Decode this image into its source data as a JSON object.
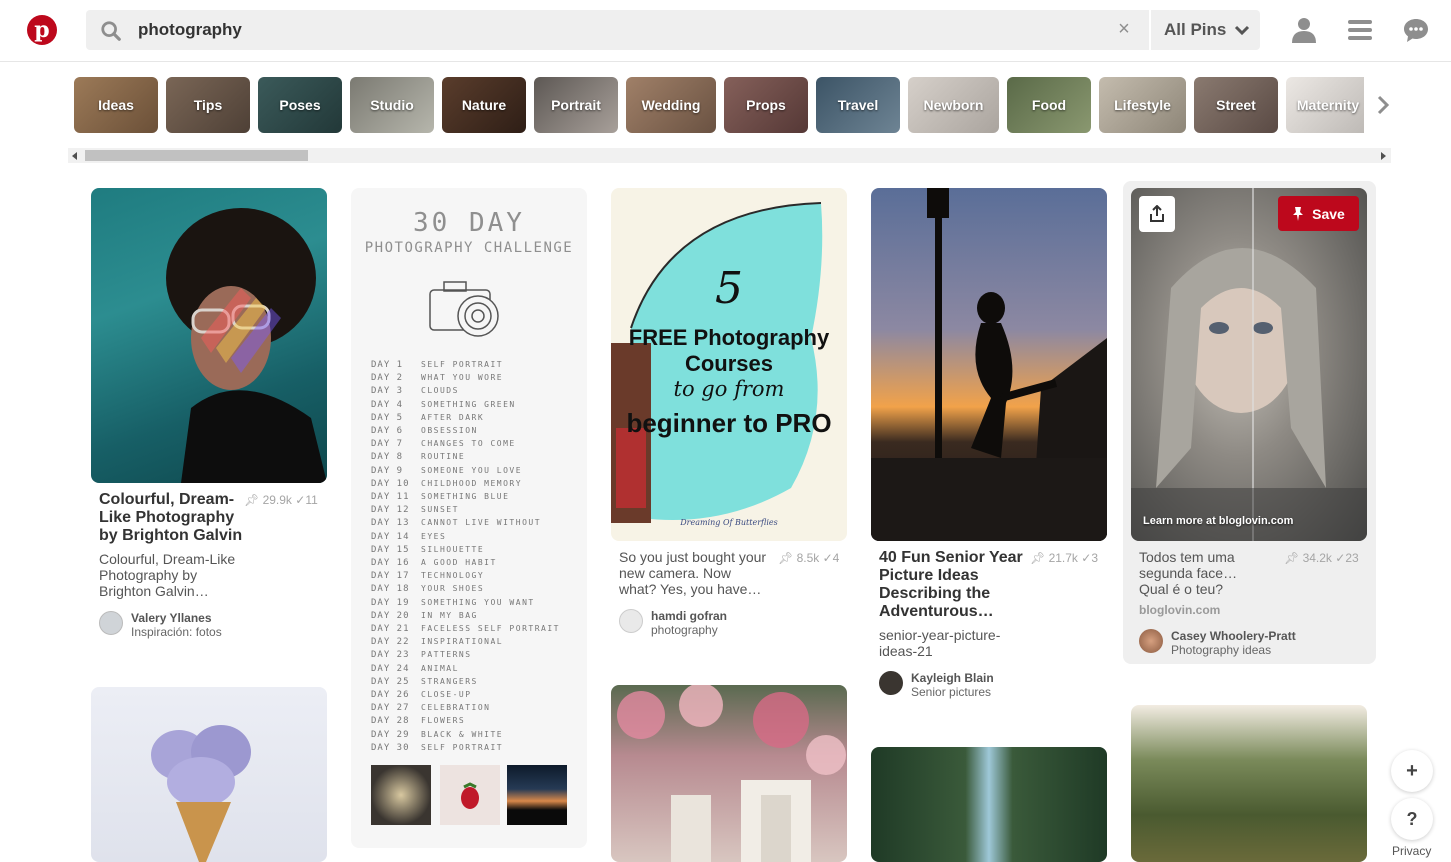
{
  "header": {
    "logo_letter": "p",
    "search_value": "photography",
    "clear_glyph": "×",
    "scope_label": "All Pins",
    "icons": [
      "pinterest-logo-icon",
      "search-icon",
      "clear-icon",
      "chevron-down-icon",
      "profile-icon",
      "menu-icon",
      "messages-icon"
    ]
  },
  "categories": [
    {
      "label": "Ideas",
      "color": "#8c6b4e"
    },
    {
      "label": "Tips",
      "color": "#6b5a4a"
    },
    {
      "label": "Poses",
      "color": "#2f4a4a"
    },
    {
      "label": "Studio",
      "color": "#9a9a90"
    },
    {
      "label": "Nature",
      "color": "#4a3326"
    },
    {
      "label": "Portrait",
      "color": "#7d7570"
    },
    {
      "label": "Wedding",
      "color": "#8a6e5a"
    },
    {
      "label": "Props",
      "color": "#6e4a48"
    },
    {
      "label": "Travel",
      "color": "#4a6070"
    },
    {
      "label": "Newborn",
      "color": "#c9c4be"
    },
    {
      "label": "Food",
      "color": "#6d7a5a"
    },
    {
      "label": "Lifestyle",
      "color": "#b0a89a"
    },
    {
      "label": "Street",
      "color": "#7a6a60"
    },
    {
      "label": "Maternity",
      "color": "#d8d4d0"
    }
  ],
  "pins": {
    "p1": {
      "title": "Colourful, Dream-Like Photography by Brighton Galvin",
      "desc": "Colourful, Dream-Like Photography by Brighton Galvin…",
      "saves": "29.9k",
      "tries": "11",
      "user": "Valery Yllanes",
      "board": "Inspiración: fotos"
    },
    "p3": {
      "desc": "So you just bought your new camera. Now what? Yes, you have…",
      "saves": "8.5k",
      "tries": "4",
      "user": "hamdi gofran",
      "board": "photography",
      "img_number": "5",
      "img_line1": "FREE Photography",
      "img_line2": "Courses",
      "img_line3": "to go from",
      "img_line4": "beginner to PRO",
      "img_credit": "Dreaming Of Butterflies"
    },
    "p4": {
      "title": "40 Fun Senior Year Picture Ideas Describing the Adventurous…",
      "desc": "senior-year-picture-ideas-21",
      "saves": "21.7k",
      "tries": "3",
      "user": "Kayleigh Blain",
      "board": "Senior pictures"
    },
    "p5": {
      "desc": "Todos tem uma segunda face… Qual é o teu?",
      "source": "bloglovin.com",
      "saves": "34.2k",
      "tries": "23",
      "user": "Casey Whoolery-Pratt",
      "board": "Photography ideas",
      "learn_more": "Learn more at bloglovin.com",
      "save_label": "Save"
    }
  },
  "challenge": {
    "title1": "30 DAY",
    "title2": "PHOTOGRAPHY CHALLENGE",
    "days": [
      {
        "d": "DAY 1",
        "t": "SELF PORTRAIT"
      },
      {
        "d": "DAY 2",
        "t": "WHAT YOU WORE"
      },
      {
        "d": "DAY 3",
        "t": "CLOUDS"
      },
      {
        "d": "DAY 4",
        "t": "SOMETHING GREEN"
      },
      {
        "d": "DAY 5",
        "t": "AFTER DARK"
      },
      {
        "d": "DAY 6",
        "t": "OBSESSION"
      },
      {
        "d": "DAY 7",
        "t": "CHANGES TO COME"
      },
      {
        "d": "DAY 8",
        "t": "ROUTINE"
      },
      {
        "d": "DAY 9",
        "t": "SOMEONE YOU LOVE"
      },
      {
        "d": "DAY 10",
        "t": "CHILDHOOD MEMORY"
      },
      {
        "d": "DAY 11",
        "t": "SOMETHING BLUE"
      },
      {
        "d": "DAY 12",
        "t": "SUNSET"
      },
      {
        "d": "DAY 13",
        "t": "CANNOT LIVE WITHOUT"
      },
      {
        "d": "DAY 14",
        "t": "EYES"
      },
      {
        "d": "DAY 15",
        "t": "SILHOUETTE"
      },
      {
        "d": "DAY 16",
        "t": "A GOOD HABIT"
      },
      {
        "d": "DAY 17",
        "t": "TECHNOLOGY"
      },
      {
        "d": "DAY 18",
        "t": "YOUR SHOES"
      },
      {
        "d": "DAY 19",
        "t": "SOMETHING YOU WANT"
      },
      {
        "d": "DAY 20",
        "t": "IN MY BAG"
      },
      {
        "d": "DAY 21",
        "t": "FACELESS SELF PORTRAIT"
      },
      {
        "d": "DAY 22",
        "t": "INSPIRATIONAL"
      },
      {
        "d": "DAY 23",
        "t": "PATTERNS"
      },
      {
        "d": "DAY 24",
        "t": "ANIMAL"
      },
      {
        "d": "DAY 25",
        "t": "STRANGERS"
      },
      {
        "d": "DAY 26",
        "t": "CLOSE-UP"
      },
      {
        "d": "DAY 27",
        "t": "CELEBRATION"
      },
      {
        "d": "DAY 28",
        "t": "FLOWERS"
      },
      {
        "d": "DAY 29",
        "t": "BLACK & WHITE"
      },
      {
        "d": "DAY 30",
        "t": "SELF PORTRAIT"
      }
    ]
  },
  "floating": {
    "add": "+",
    "help": "?",
    "privacy": "Privacy"
  }
}
